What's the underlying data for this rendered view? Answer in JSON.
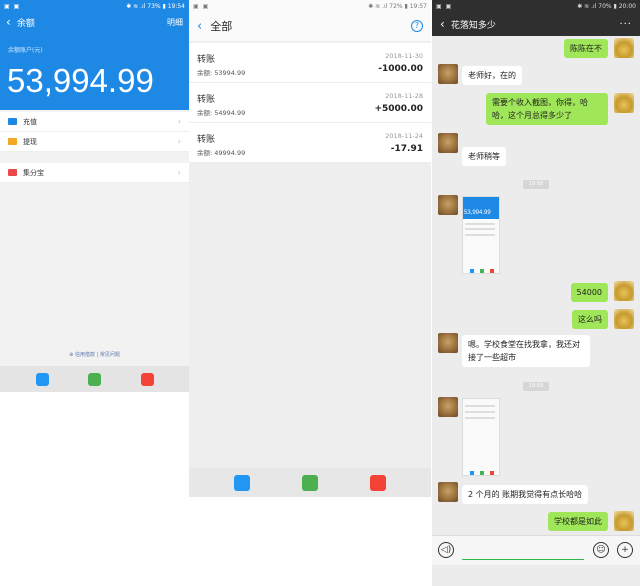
{
  "panel1": {
    "status": {
      "left_icons": "▣ ▣",
      "right": "✱ ≋ .ıl 73% ▮ 19:54"
    },
    "nav": {
      "back": "‹",
      "title": "余额",
      "detail": "明细"
    },
    "balance_label": "余额账户(元)",
    "balance": "53,994.99",
    "rows": [
      {
        "label": "充值",
        "icon_color": "#1e88e5"
      },
      {
        "label": "提现",
        "icon_color": "#f5a623"
      },
      {
        "label": "集分宝",
        "icon_color": "#e94b4b"
      }
    ],
    "chevron": "›",
    "footer_text": "⊕ 信用借款  |  常见问题",
    "bottom_icons": [
      "#2196f3",
      "#4caf50",
      "#f44336"
    ]
  },
  "panel2": {
    "status": {
      "left_icons": "▣ ▣",
      "right": "✱ ≋ .ıl 72% ▮ 19:57"
    },
    "nav": {
      "back": "‹",
      "title": "全部",
      "help": "?"
    },
    "transactions": [
      {
        "title": "转账",
        "balance": "余额: 53994.99",
        "date": "2018-11-30",
        "amount": "-1000.00"
      },
      {
        "title": "转账",
        "balance": "余额: 54994.99",
        "date": "2018-11-28",
        "amount": "+5000.00"
      },
      {
        "title": "转账",
        "balance": "余额: 49994.99",
        "date": "2018-11-24",
        "amount": "-17.91"
      }
    ],
    "bottom_icons": [
      "#2196f3",
      "#4caf50",
      "#f44336"
    ]
  },
  "panel3": {
    "status": {
      "left_icons": "▣ ▣",
      "right": "✱ ≋ .ıl 70% ▮ 20:00"
    },
    "nav": {
      "back": "‹",
      "title": "花落知多少",
      "more": "···"
    },
    "messages": [
      {
        "dir": "out",
        "text": "陈陈在不"
      },
      {
        "dir": "in",
        "text": "老师好，在的"
      },
      {
        "dir": "out",
        "text": "需要个收入截图，你得，哈哈，这个月总得多少了"
      },
      {
        "dir": "in",
        "text": "老师稍等"
      },
      {
        "dir": "in",
        "text": "53,994.99"
      },
      {
        "dir": "out",
        "text": "54000"
      },
      {
        "dir": "out",
        "text": "这么吗"
      },
      {
        "dir": "in",
        "text": "嗯。学校食堂在找我拿，我还对接了一些超市"
      },
      {
        "dir": "in",
        "text": "2 个月的  账期我觉得有点长哈哈"
      },
      {
        "dir": "out",
        "text": "学校都是如此"
      }
    ],
    "timestamps": [
      "19:58",
      "19:59"
    ],
    "input": {
      "voice": "◁)",
      "emoji": "☺",
      "plus": "+"
    }
  }
}
